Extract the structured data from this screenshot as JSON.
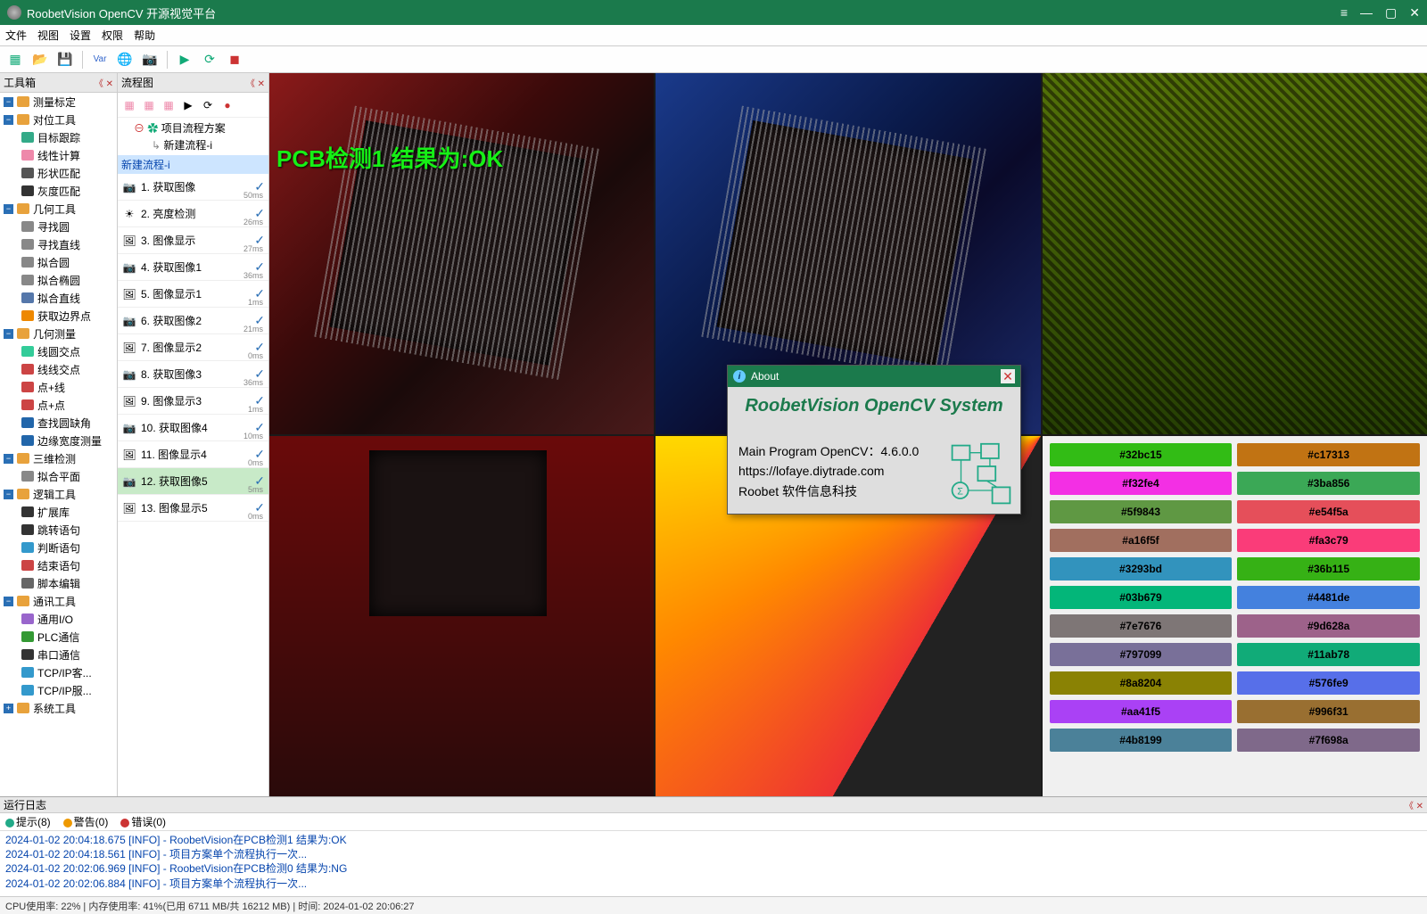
{
  "window": {
    "title": "RoobetVision OpenCV 开源视觉平台"
  },
  "menu": [
    "文件",
    "视图",
    "设置",
    "权限",
    "帮助"
  ],
  "panels": {
    "toolbox": "工具箱",
    "flowchart": "流程图",
    "log": "运行日志"
  },
  "toolbox": {
    "cats": [
      {
        "kind": "minus",
        "icon": "#6ab",
        "label": "测量标定",
        "sub": []
      },
      {
        "kind": "minus",
        "icon": "",
        "label": "对位工具",
        "sub": [
          {
            "c": "#3a8",
            "t": "目标跟踪"
          },
          {
            "c": "#e8a",
            "t": "线性计算"
          },
          {
            "c": "#555",
            "t": "形状匹配"
          },
          {
            "c": "#333",
            "t": "灰度匹配"
          }
        ]
      },
      {
        "kind": "minus",
        "icon": "",
        "label": "几何工具",
        "sub": [
          {
            "c": "#888",
            "t": "寻找圆"
          },
          {
            "c": "#888",
            "t": "寻找直线"
          },
          {
            "c": "#888",
            "t": "拟合圆"
          },
          {
            "c": "#888",
            "t": "拟合椭圆"
          },
          {
            "c": "#57a",
            "t": "拟合直线"
          },
          {
            "c": "#e80",
            "t": "获取边界点"
          }
        ]
      },
      {
        "kind": "minus",
        "icon": "",
        "label": "几何测量",
        "sub": [
          {
            "c": "#3c9",
            "t": "线圆交点"
          },
          {
            "c": "#c44",
            "t": "线线交点"
          },
          {
            "c": "#c44",
            "t": "点+线"
          },
          {
            "c": "#c44",
            "t": "点+点"
          },
          {
            "c": "#26a",
            "t": "查找圆缺角"
          },
          {
            "c": "#26a",
            "t": "边缘宽度测量"
          }
        ]
      },
      {
        "kind": "minus",
        "icon": "",
        "label": "三维检测",
        "sub": [
          {
            "c": "#888",
            "t": "拟合平面"
          }
        ]
      },
      {
        "kind": "minus",
        "icon": "",
        "label": "逻辑工具",
        "sub": [
          {
            "c": "#333",
            "t": "扩展库"
          },
          {
            "c": "#333",
            "t": "跳转语句"
          },
          {
            "c": "#39c",
            "t": "判断语句"
          },
          {
            "c": "#c44",
            "t": "结束语句"
          },
          {
            "c": "#666",
            "t": "脚本编辑"
          }
        ]
      },
      {
        "kind": "minus",
        "icon": "",
        "label": "通讯工具",
        "sub": [
          {
            "c": "#96c",
            "t": "通用I/O"
          },
          {
            "c": "#393",
            "t": "PLC通信"
          },
          {
            "c": "#333",
            "t": "串口通信"
          },
          {
            "c": "#39c",
            "t": "TCP/IP客..."
          },
          {
            "c": "#39c",
            "t": "TCP/IP服..."
          }
        ]
      },
      {
        "kind": "plus",
        "icon": "",
        "label": "系统工具",
        "sub": []
      }
    ]
  },
  "flow": {
    "tree": {
      "root": "项目流程方案",
      "child": "新建流程-i"
    },
    "current": "新建流程-i",
    "steps": [
      {
        "n": "1. 获取图像",
        "ms": "50ms",
        "ic": "cam"
      },
      {
        "n": "2. 亮度检测",
        "ms": "26ms",
        "ic": "sun"
      },
      {
        "n": "3. 图像显示",
        "ms": "27ms",
        "ic": "img"
      },
      {
        "n": "4. 获取图像1",
        "ms": "36ms",
        "ic": "cam"
      },
      {
        "n": "5. 图像显示1",
        "ms": "1ms",
        "ic": "img"
      },
      {
        "n": "6. 获取图像2",
        "ms": "21ms",
        "ic": "cam"
      },
      {
        "n": "7. 图像显示2",
        "ms": "0ms",
        "ic": "img"
      },
      {
        "n": "8. 获取图像3",
        "ms": "36ms",
        "ic": "cam"
      },
      {
        "n": "9. 图像显示3",
        "ms": "1ms",
        "ic": "img"
      },
      {
        "n": "10. 获取图像4",
        "ms": "10ms",
        "ic": "cam"
      },
      {
        "n": "11. 图像显示4",
        "ms": "0ms",
        "ic": "img"
      },
      {
        "n": "12. 获取图像5",
        "ms": "5ms",
        "ic": "cam",
        "sel": true
      },
      {
        "n": "13. 图像显示5",
        "ms": "0ms",
        "ic": "img"
      }
    ]
  },
  "viewport": {
    "overlay_text": "PCB检测1  结果为:",
    "overlay_result": "OK",
    "swatches": [
      [
        "#32bc15",
        "#32bc15"
      ],
      [
        "#c17313",
        "#c17313"
      ],
      [
        "#f32fe4",
        "#f32fe4"
      ],
      [
        "#3ba856",
        "#3ba856"
      ],
      [
        "#5f9843",
        "#5f9843"
      ],
      [
        "#e54f5a",
        "#e54f5a"
      ],
      [
        "#a16f5f",
        "#a16f5f"
      ],
      [
        "#fa3c79",
        "#fa3c79"
      ],
      [
        "#3293bd",
        "#3293bd"
      ],
      [
        "#36b115",
        "#36b115"
      ],
      [
        "#03b679",
        "#03b679"
      ],
      [
        "#4481de",
        "#4481de"
      ],
      [
        "#7e7676",
        "#7e7676"
      ],
      [
        "#9d628a",
        "#9d628a"
      ],
      [
        "#797099",
        "#797099"
      ],
      [
        "#11ab78",
        "#11ab78"
      ],
      [
        "#8a8204",
        "#8a8204"
      ],
      [
        "#576fe9",
        "#576fe9"
      ],
      [
        "#aa41f5",
        "#aa41f5"
      ],
      [
        "#996f31",
        "#996f31"
      ],
      [
        "#4b8199",
        "#4b8199"
      ],
      [
        "#7f698a",
        "#7f698a"
      ]
    ]
  },
  "about": {
    "caption": "About",
    "title": "RoobetVision OpenCV System",
    "line1_label": "Main Program OpenCV：",
    "line1_value": "4.6.0.0",
    "line2": "https://lofaye.diytrade.com",
    "line3": "Roobet 软件信息科技"
  },
  "log": {
    "tabs": {
      "hint": "提示(8)",
      "warn": "警告(0)",
      "err": "错误(0)"
    },
    "lines": [
      "2024-01-02 20:04:18.675 [INFO]  -  RoobetVision在PCB检测1 结果为:OK",
      "2024-01-02 20:04:18.561 [INFO]  -  项目方案单个流程执行一次...",
      "2024-01-02 20:02:06.969 [INFO]  -  RoobetVision在PCB检测0 结果为:NG",
      "2024-01-02 20:02:06.884 [INFO]  -  项目方案单个流程执行一次..."
    ]
  },
  "status": "CPU使用率: 22%  |  内存使用率: 41%(已用 6711 MB/共 16212 MB)  |  时间: 2024-01-02 20:06:27"
}
